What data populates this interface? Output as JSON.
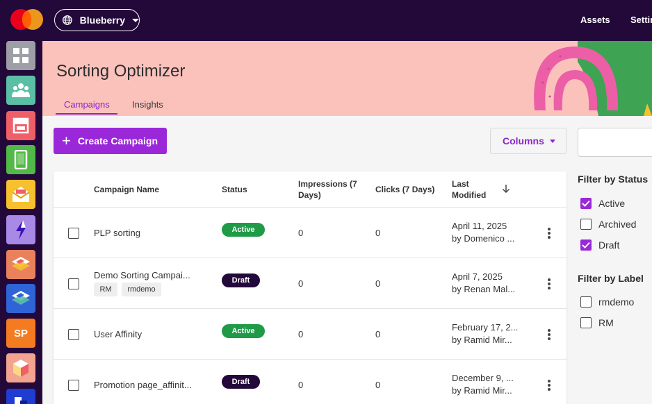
{
  "topbar": {
    "site": "Blueberry",
    "nav": [
      "Assets",
      "Settin"
    ]
  },
  "sidebar": {
    "apps": [
      {
        "icon": "dashboard-grid-icon",
        "color": "#9e9ea6"
      },
      {
        "icon": "audience-icon",
        "color": "#5bbfa6"
      },
      {
        "icon": "layout-icon",
        "color": "#ef5f68"
      },
      {
        "icon": "mobile-icon",
        "color": "#52b847"
      },
      {
        "icon": "email-icon",
        "color": "#f6c02f"
      },
      {
        "icon": "lightning-icon",
        "color": "#a889e6"
      },
      {
        "icon": "layers-orange-icon",
        "color": "#e9825c"
      },
      {
        "icon": "layers-blue-icon",
        "color": "#2f63d6"
      },
      {
        "icon": "sp-icon",
        "color": "#f57b20",
        "text": "SP"
      },
      {
        "icon": "box-icon",
        "color": "#f2a490"
      },
      {
        "icon": "blue-app-icon",
        "color": "#1f3dd1"
      }
    ]
  },
  "header": {
    "title": "Sorting Optimizer",
    "tabs": [
      "Campaigns",
      "Insights"
    ]
  },
  "toolbar": {
    "create_label": "Create Campaign",
    "columns_label": "Columns"
  },
  "table": {
    "headers": {
      "name": "Campaign Name",
      "status": "Status",
      "impressions_1": "Impressions (7",
      "impressions_2": "Days)",
      "clicks": "Clicks (7 Days)",
      "modified_1": "Last",
      "modified_2": "Modified"
    },
    "rows": [
      {
        "name": "PLP sorting",
        "status": "Active",
        "impressions": "0",
        "clicks": "0",
        "date": "April 11, 2025",
        "by": "by Domenico ...",
        "labels": []
      },
      {
        "name": "Demo Sorting Campai...",
        "status": "Draft",
        "impressions": "0",
        "clicks": "0",
        "date": "April 7, 2025",
        "by": "by Renan Mal...",
        "labels": [
          "RM",
          "rmdemo"
        ]
      },
      {
        "name": "User Affinity",
        "status": "Active",
        "impressions": "0",
        "clicks": "0",
        "date": "February 17, 2...",
        "by": "by Ramid Mir...",
        "labels": []
      },
      {
        "name": "Promotion page_affinit...",
        "status": "Draft",
        "impressions": "0",
        "clicks": "0",
        "date": "December 9, ...",
        "by": "by Ramid Mir...",
        "labels": []
      }
    ]
  },
  "filters": {
    "status_title": "Filter by Status",
    "status": [
      {
        "label": "Active",
        "checked": true
      },
      {
        "label": "Archived",
        "checked": false
      },
      {
        "label": "Draft",
        "checked": true
      }
    ],
    "label_title": "Filter by Label",
    "labels": [
      {
        "label": "rmdemo",
        "checked": false
      },
      {
        "label": "RM",
        "checked": false
      }
    ]
  },
  "colors": {
    "brand_dark": "#23083a",
    "accent": "#9a28d8",
    "header_bg": "#fbc2bc",
    "active": "#1f9b48"
  }
}
